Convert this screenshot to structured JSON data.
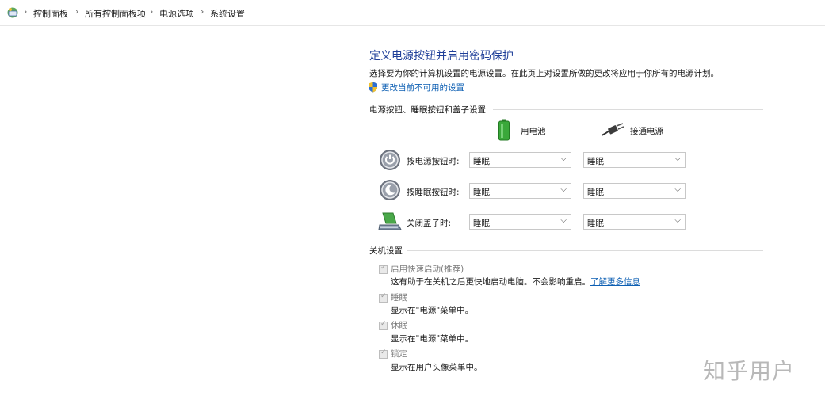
{
  "breadcrumb": {
    "items": [
      "控制面板",
      "所有控制面板项",
      "电源选项",
      "系统设置"
    ]
  },
  "page": {
    "title": "定义电源按钮并启用密码保护",
    "description": "选择要为你的计算机设置的电源设置。在此页上对设置所做的更改将应用于你所有的电源计划。",
    "change_link": "更改当前不可用的设置"
  },
  "power_section": {
    "header": "电源按钮、睡眠按钮和盖子设置",
    "columns": [
      "用电池",
      "接通电源"
    ],
    "rows": [
      {
        "label": "按电源按钮时:",
        "battery": "睡眠",
        "plugged": "睡眠",
        "icon": "power-icon"
      },
      {
        "label": "按睡眠按钮时:",
        "battery": "睡眠",
        "plugged": "睡眠",
        "icon": "sleep-icon"
      },
      {
        "label": "关闭盖子时:",
        "battery": "睡眠",
        "plugged": "睡眠",
        "icon": "laptop-lid-icon"
      }
    ]
  },
  "shutdown_section": {
    "header": "关机设置",
    "items": [
      {
        "label": "启用快速启动(推荐)",
        "description": "这有助于在关机之后更快地启动电脑。不会影响重启。",
        "link": "了解更多信息",
        "checked": true
      },
      {
        "label": "睡眠",
        "description": "显示在\"电源\"菜单中。",
        "checked": true
      },
      {
        "label": "休眠",
        "description": "显示在\"电源\"菜单中。",
        "checked": true
      },
      {
        "label": "锁定",
        "description": "显示在用户头像菜单中。",
        "checked": true
      }
    ]
  },
  "watermark": "知乎用户",
  "colors": {
    "title": "#1f3f99",
    "link": "#0d5fb3",
    "battery_green": "#3aa83a"
  }
}
